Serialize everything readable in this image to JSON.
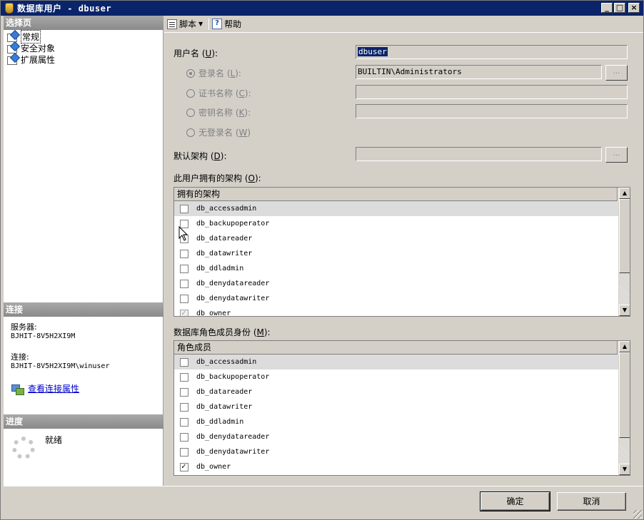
{
  "window": {
    "title_cn": "数据库用户",
    "title_sep": " - ",
    "title_user": "dbuser"
  },
  "left": {
    "select_page_header": "选择页",
    "pages": [
      {
        "label": "常规",
        "selected": true
      },
      {
        "label": "安全对象",
        "selected": false
      },
      {
        "label": "扩展属性",
        "selected": false
      }
    ],
    "connection_header": "连接",
    "server_label": "服务器:",
    "server_value": "BJHIT-8V5H2XI9M",
    "connection_label": "连接:",
    "connection_value": "BJHIT-8V5H2XI9M\\winuser",
    "view_conn_link": "查看连接属性",
    "progress_header": "进度",
    "progress_status": "就绪"
  },
  "toolbar": {
    "script_label": "脚本",
    "help_label": "帮助"
  },
  "form": {
    "username_label": "用户名",
    "username_key": "U",
    "username_value": "dbuser",
    "login_label": "登录名",
    "login_key": "L",
    "login_value": "BUILTIN\\Administrators",
    "cert_label": "证书名称",
    "cert_key": "C",
    "key_label": "密钥名称",
    "key_key": "K",
    "nologin_label": "无登录名",
    "nologin_key": "W",
    "default_schema_label": "默认架构",
    "default_schema_key": "D",
    "owned_schemas_label": "此用户拥有的架构",
    "owned_schemas_key": "O",
    "role_membership_label": "数据库角色成员身份",
    "role_membership_key": "M",
    "browse_label": "..."
  },
  "owned_schemas": {
    "header": "拥有的架构",
    "rows": [
      {
        "name": "db_accessadmin",
        "checked": false
      },
      {
        "name": "db_backupoperator",
        "checked": false
      },
      {
        "name": "db_datareader",
        "checked": false
      },
      {
        "name": "db_datawriter",
        "checked": false
      },
      {
        "name": "db_ddladmin",
        "checked": false
      },
      {
        "name": "db_denydatareader",
        "checked": false
      },
      {
        "name": "db_denydatawriter",
        "checked": false
      },
      {
        "name": "db_owner",
        "checked": true
      }
    ]
  },
  "role_members": {
    "header": "角色成员",
    "rows": [
      {
        "name": "db_accessadmin",
        "checked": false
      },
      {
        "name": "db_backupoperator",
        "checked": false
      },
      {
        "name": "db_datareader",
        "checked": false
      },
      {
        "name": "db_datawriter",
        "checked": false
      },
      {
        "name": "db_ddladmin",
        "checked": false
      },
      {
        "name": "db_denydatareader",
        "checked": false
      },
      {
        "name": "db_denydatawriter",
        "checked": false
      },
      {
        "name": "db_owner",
        "checked": true
      }
    ]
  },
  "buttons": {
    "ok": "确定",
    "cancel": "取消"
  }
}
